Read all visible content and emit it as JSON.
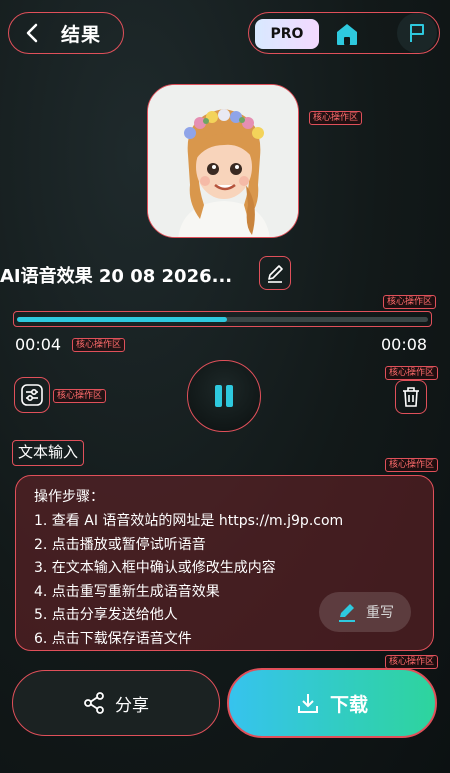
{
  "header": {
    "title": "结果",
    "pro_label": "PRO"
  },
  "tags": {
    "core": "核心操作区"
  },
  "audio": {
    "name": "AI语音效果 20 08 2026...",
    "current_time": "00:04",
    "total_time": "00:08",
    "progress": 0.51
  },
  "text_input": {
    "label": "文本输入",
    "steps_title": "操作步骤：",
    "steps": [
      "1. 查看 AI 语音效站的网址是 https://m.j9p.com",
      "2. 点击播放或暂停试听语音",
      "3. 在文本输入框中确认或修改生成内容",
      "4. 点击重写重新生成语音效果",
      "5. 点击分享发送给他人",
      "6. 点击下载保存语音文件"
    ],
    "rewrite_label": "重写"
  },
  "actions": {
    "share_label": "分享",
    "download_label": "下载"
  },
  "colors": {
    "accent": "#2ec9de",
    "annotation": "#e0505a",
    "download_from": "#36c3ee",
    "download_to": "#2ed49d"
  }
}
